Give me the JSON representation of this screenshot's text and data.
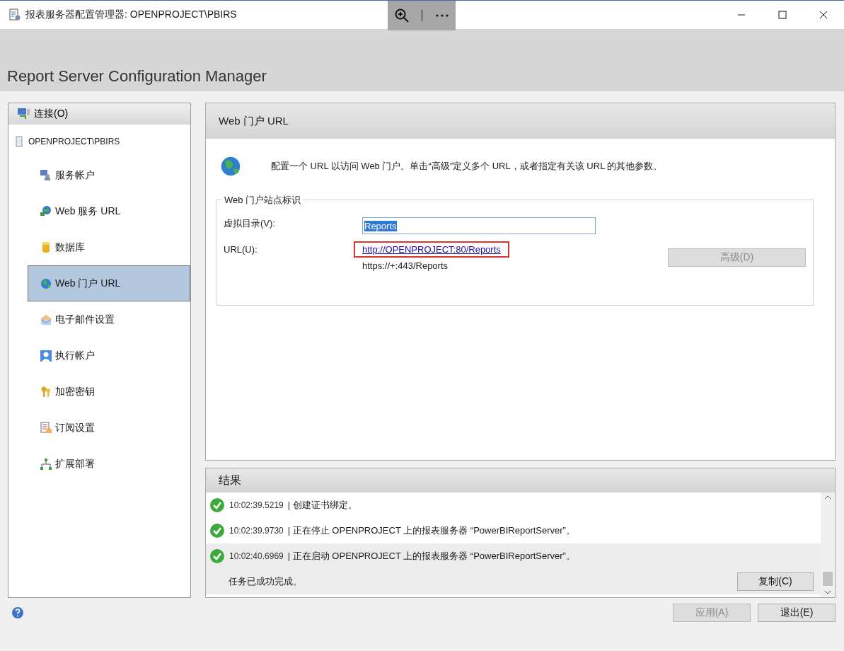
{
  "window": {
    "title": "报表服务器配置管理器: OPENPROJECT\\PBIRS"
  },
  "header": {
    "title": "Report Server Configuration Manager"
  },
  "sidebar": {
    "connect_button": "连接(O)",
    "server": "OPENPROJECT\\PBIRS",
    "items": [
      {
        "label": "服务帐户",
        "kind": "account",
        "selected": false
      },
      {
        "label": "Web 服务 URL",
        "kind": "webservice",
        "selected": false
      },
      {
        "label": "数据库",
        "kind": "database",
        "selected": false
      },
      {
        "label": "Web 门户 URL",
        "kind": "globe",
        "selected": true
      },
      {
        "label": "电子邮件设置",
        "kind": "email",
        "selected": false
      },
      {
        "label": "执行帐户",
        "kind": "user",
        "selected": false
      },
      {
        "label": "加密密钥",
        "kind": "keys",
        "selected": false
      },
      {
        "label": "订阅设置",
        "kind": "subscription",
        "selected": false
      },
      {
        "label": "扩展部署",
        "kind": "scaleout",
        "selected": false
      }
    ]
  },
  "page": {
    "title": "Web 门户 URL",
    "description": "配置一个 URL 以访问 Web 门户。单击“高级”定义多个 URL，或者指定有关该 URL 的其他参数。",
    "group": {
      "legend": "Web 门户站点标识",
      "virtual_directory": {
        "label": "虚拟目录(V):",
        "value": "Reports"
      },
      "url": {
        "label": "URL(U):",
        "entries": [
          {
            "text": "http://OPENPROJECT:80/Reports",
            "kind": "link",
            "highlighted": true
          },
          {
            "text": "https://+:443/Reports",
            "kind": "plain",
            "highlighted": false
          }
        ]
      },
      "advanced_button": {
        "label": "高级(D)",
        "disabled": true
      }
    }
  },
  "results": {
    "title": "结果",
    "entries": [
      {
        "time": "10:02:39.5219",
        "message": "| 创建证书绑定。",
        "selected": false
      },
      {
        "time": "10:02:39.9730",
        "message": "| 正在停止 OPENPROJECT 上的报表服务器 “PowerBIReportServer”。",
        "selected": false
      },
      {
        "time": "10:02:40.6969",
        "message": "| 正在启动 OPENPROJECT 上的报表服务器 “PowerBIReportServer”。",
        "selected": true
      }
    ],
    "status": "任务已成功完成。",
    "copy_button": "复制(C)"
  },
  "footer": {
    "buttons": [
      {
        "label": "应用(A)",
        "disabled": true
      },
      {
        "label": "退出(E)",
        "disabled": false
      }
    ]
  }
}
